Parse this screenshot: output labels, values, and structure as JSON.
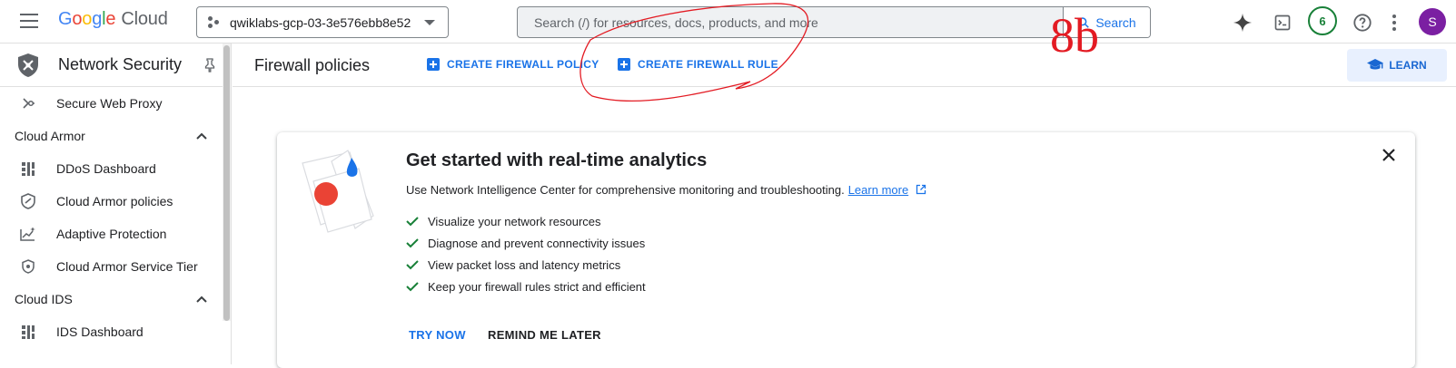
{
  "header": {
    "logo_google": [
      "G",
      "o",
      "o",
      "g",
      "l",
      "e"
    ],
    "logo_cloud": "Cloud",
    "project_name": "qwiklabs-gcp-03-3e576ebb8e52",
    "search_placeholder": "Search (/) for resources, docs, products, and more",
    "search_button": "Search",
    "notification_count": "6",
    "avatar_initial": "S"
  },
  "sidebar": {
    "title": "Network Security",
    "items": [
      {
        "type": "item",
        "label": "Secure Web Proxy",
        "icon": "proxy-icon"
      },
      {
        "type": "section",
        "label": "Cloud Armor"
      },
      {
        "type": "item",
        "label": "DDoS Dashboard",
        "icon": "dashboard-icon"
      },
      {
        "type": "item",
        "label": "Cloud Armor policies",
        "icon": "shield-icon"
      },
      {
        "type": "item",
        "label": "Adaptive Protection",
        "icon": "adaptive-icon"
      },
      {
        "type": "item",
        "label": "Cloud Armor Service Tier",
        "icon": "tier-icon"
      },
      {
        "type": "section",
        "label": "Cloud IDS"
      },
      {
        "type": "item",
        "label": "IDS Dashboard",
        "icon": "dashboard-icon"
      }
    ]
  },
  "page": {
    "title": "Firewall policies",
    "actions": [
      "CREATE FIREWALL POLICY",
      "CREATE FIREWALL RULE"
    ],
    "learn": "LEARN"
  },
  "card": {
    "title": "Get started with real-time analytics",
    "description": "Use Network Intelligence Center for comprehensive monitoring and troubleshooting.",
    "learn_more": "Learn more",
    "checks": [
      "Visualize your network resources",
      "Diagnose and prevent connectivity issues",
      "View packet loss and latency metrics",
      "Keep your firewall rules strict and efficient"
    ],
    "try_now": "TRY NOW",
    "remind_later": "REMIND ME LATER"
  },
  "annotation": {
    "text": "8b"
  },
  "colors": {
    "accent": "#1a73e8",
    "annotation": "#e31b23",
    "check": "#188038"
  }
}
